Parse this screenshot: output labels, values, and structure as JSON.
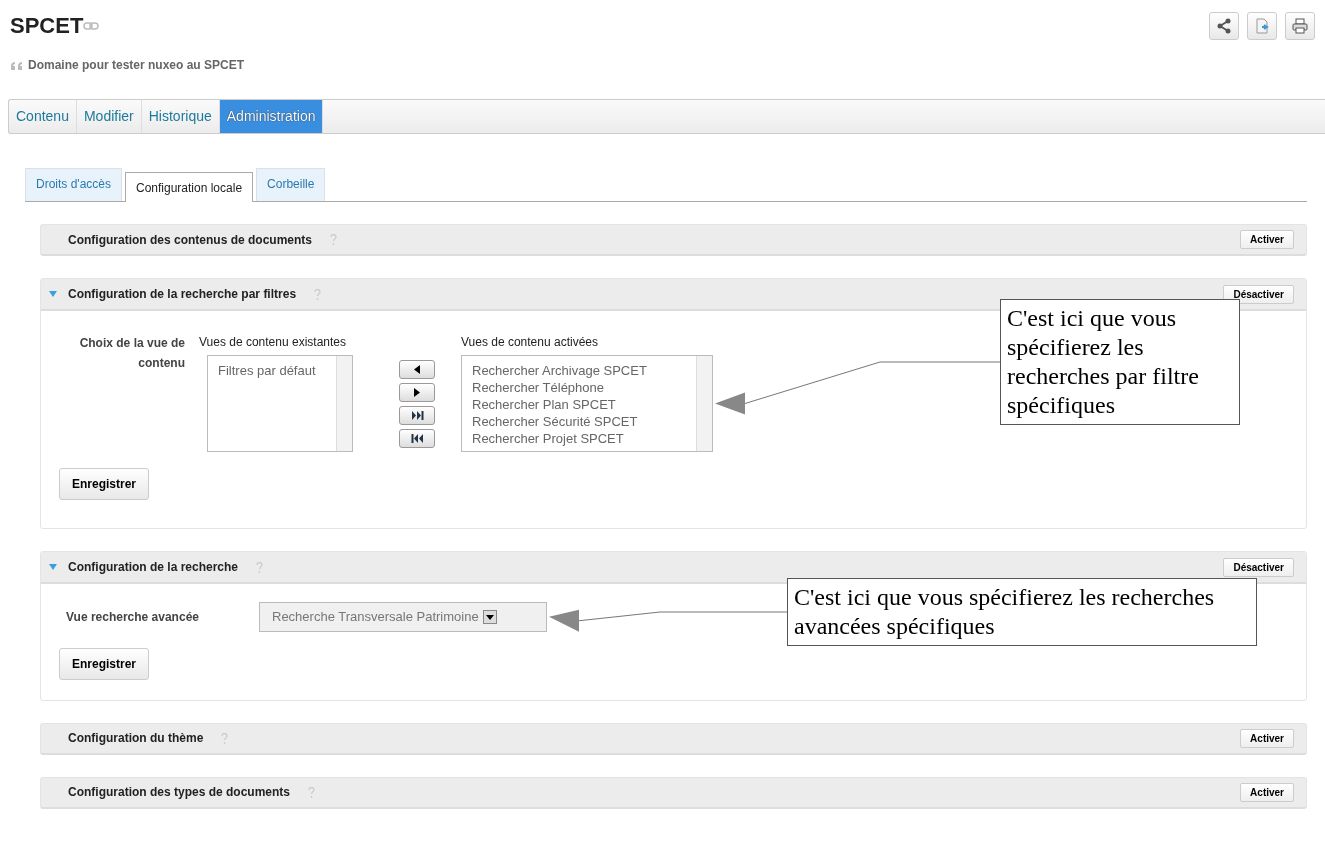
{
  "header": {
    "title": "SPCET",
    "description": "Domaine pour tester nuxeo au SPCET"
  },
  "main_tabs": [
    {
      "label": "Contenu",
      "selected": false
    },
    {
      "label": "Modifier",
      "selected": false
    },
    {
      "label": "Historique",
      "selected": false
    },
    {
      "label": "Administration",
      "selected": true
    }
  ],
  "sub_tabs": [
    {
      "label": "Droits d'accès",
      "selected": false
    },
    {
      "label": "Configuration locale",
      "selected": true
    },
    {
      "label": "Corbeille",
      "selected": false
    }
  ],
  "panels": [
    {
      "title": "Configuration des contenus de documents",
      "expanded": false,
      "button": "Activer"
    },
    {
      "title": "Configuration de la recherche par filtres",
      "expanded": true,
      "button": "Désactiver",
      "kind": "transfer",
      "label": "Choix de la vue de contenu",
      "available_title": "Vues de contenu existantes",
      "available": [
        "Filtres par défaut"
      ],
      "enabled_title": "Vues de contenu activées",
      "enabled": [
        "Rechercher Archivage SPCET",
        "Rechercher Téléphone",
        "Rechercher Plan SPCET",
        "Rechercher Sécurité SPCET",
        "Rechercher Projet SPCET"
      ],
      "save": "Enregistrer",
      "callout": "C'est ici que vous spécifierez les recherches par filtre spécifiques"
    },
    {
      "title": "Configuration de la recherche",
      "expanded": true,
      "button": "Désactiver",
      "kind": "select",
      "label": "Vue recherche avancée",
      "value": "Recherche Transversale Patrimoine",
      "save": "Enregistrer",
      "callout": "C'est ici que vous spécifierez les recherches avancées spécifiques"
    },
    {
      "title": "Configuration du thème",
      "expanded": false,
      "button": "Activer"
    },
    {
      "title": "Configuration des types de documents",
      "expanded": false,
      "button": "Activer"
    }
  ]
}
